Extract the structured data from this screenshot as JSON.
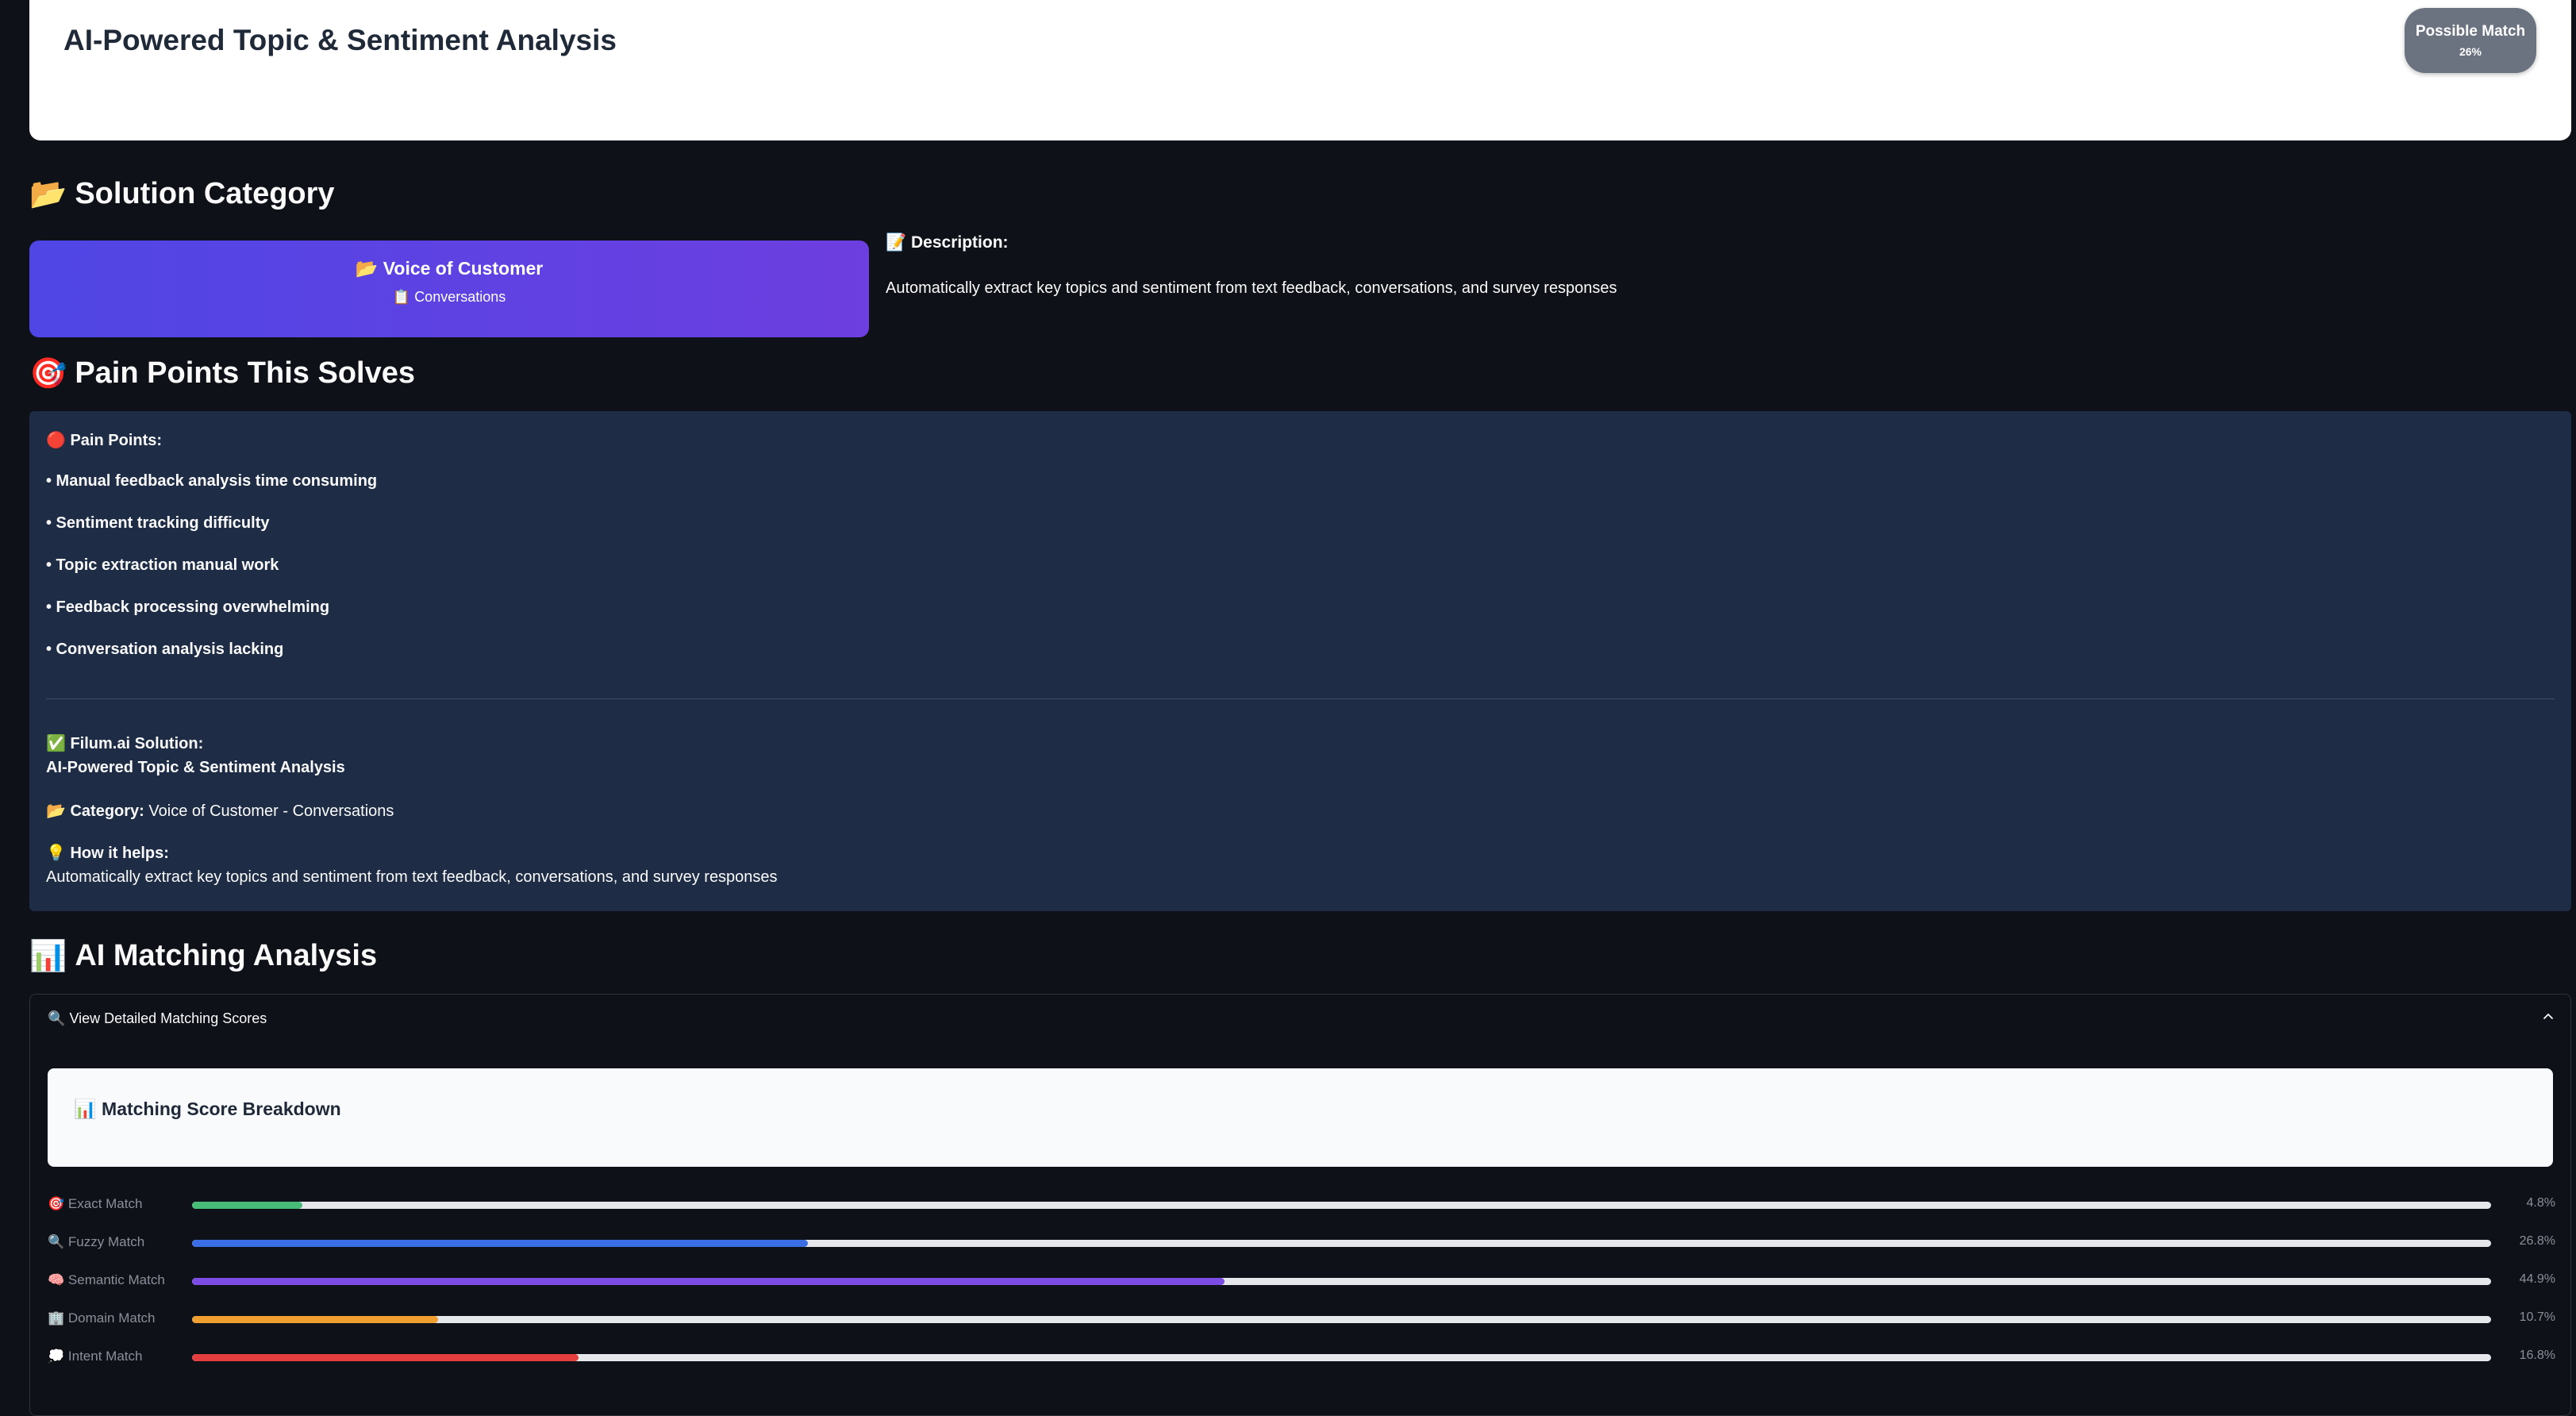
{
  "header": {
    "title": "AI-Powered Topic & Sentiment Analysis",
    "badge_label": "Possible Match",
    "badge_value": "26%"
  },
  "solution_category": {
    "heading_icon": "📂",
    "heading": "Solution Category",
    "card_main_icon": "📂",
    "card_main": "Voice of Customer",
    "card_sub_icon": "📋",
    "card_sub": "Conversations",
    "description_icon": "📝",
    "description_label": "Description:",
    "description_text": "Automatically extract key topics and sentiment from text feedback, conversations, and survey responses"
  },
  "pain_points": {
    "heading_icon": "🎯",
    "heading": "Pain Points This Solves",
    "label_icon": "🔴",
    "label": "Pain Points:",
    "items": [
      "• Manual feedback analysis time consuming",
      "• Sentiment tracking difficulty",
      "• Topic extraction manual work",
      "• Feedback processing overwhelming",
      "• Conversation analysis lacking"
    ],
    "solution_icon": "✅",
    "solution_label": "Filum.ai Solution:",
    "solution_name": "AI-Powered Topic & Sentiment Analysis",
    "category_icon": "📂",
    "category_label": "Category:",
    "category_value": "Voice of Customer - Conversations",
    "how_icon": "💡",
    "how_label": "How it helps:",
    "how_text": "Automatically extract key topics and sentiment from text feedback, conversations, and survey responses"
  },
  "ai_matching": {
    "heading_icon": "📊",
    "heading": "AI Matching Analysis",
    "expander_icon": "🔍",
    "expander_label": "View Detailed Matching Scores",
    "breakdown_icon": "📊",
    "breakdown_title": "Matching Score Breakdown",
    "scores": [
      {
        "icon": "🎯",
        "label": "Exact Match",
        "value": "4.8%",
        "fraction": 0.048,
        "color": "#48bb78"
      },
      {
        "icon": "🔍",
        "label": "Fuzzy Match",
        "value": "26.8%",
        "fraction": 0.268,
        "color": "#3b6ee5"
      },
      {
        "icon": "🧠",
        "label": "Semantic Match",
        "value": "44.9%",
        "fraction": 0.449,
        "color": "#7c4ce4"
      },
      {
        "icon": "🏢",
        "label": "Domain Match",
        "value": "10.7%",
        "fraction": 0.107,
        "color": "#f0a030"
      },
      {
        "icon": "💭",
        "label": "Intent Match",
        "value": "16.8%",
        "fraction": 0.168,
        "color": "#e53e3e"
      }
    ]
  }
}
